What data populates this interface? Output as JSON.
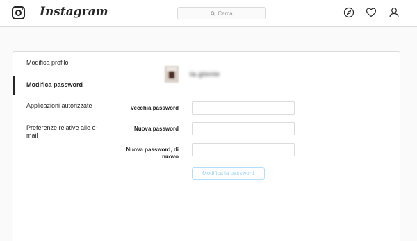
{
  "header": {
    "brand": "Instagram",
    "search_placeholder": "Cerca",
    "icons": [
      "instagram-logo-icon",
      "search-icon",
      "compass-icon",
      "heart-icon",
      "profile-icon"
    ]
  },
  "sidebar": {
    "items": [
      {
        "label": "Modifica profilo",
        "active": false
      },
      {
        "label": "Modifica password",
        "active": true
      },
      {
        "label": "Applicazioni autorizzate",
        "active": false
      },
      {
        "label": "Preferenze relative alle e-mail",
        "active": false
      }
    ]
  },
  "form": {
    "username": "ta.gtente",
    "fields": [
      {
        "label": "Vecchia password",
        "value": ""
      },
      {
        "label": "Nuova password",
        "value": ""
      },
      {
        "label": "Nuova password, di nuovo",
        "value": ""
      }
    ],
    "submit_label": "Modifica la password"
  },
  "colors": {
    "border": "#dbdbdb",
    "background": "#fafafa",
    "button_disabled_text": "#9fd3f7",
    "button_disabled_border": "#b2dffc"
  }
}
